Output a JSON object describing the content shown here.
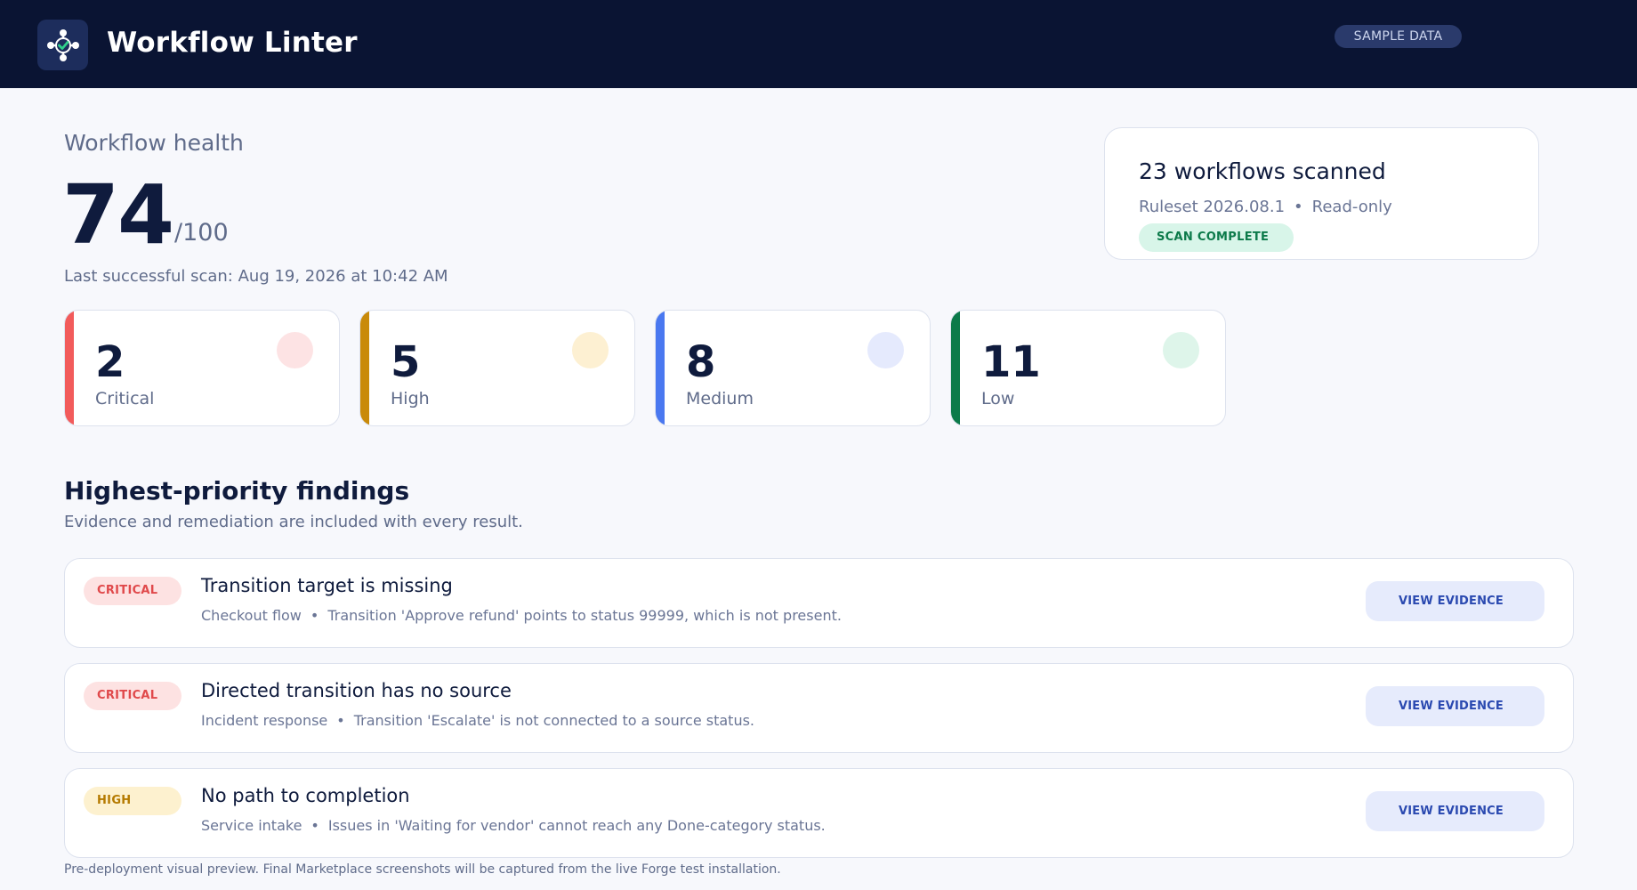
{
  "header": {
    "app_title": "Workflow Linter",
    "sample_badge": "SAMPLE DATA"
  },
  "health": {
    "label": "Workflow health",
    "score": "74",
    "score_max": "/100",
    "last_scan": "Last successful scan: Aug 19, 2026 at 10:42 AM"
  },
  "scan": {
    "title": "23 workflows scanned",
    "ruleset": "Ruleset 2026.08.1",
    "separator": "•",
    "mode": "Read-only",
    "status": "SCAN COMPLETE"
  },
  "severity": [
    {
      "count": "2",
      "label": "Critical",
      "accent": "#f25b5b",
      "circle": "#fde3e4"
    },
    {
      "count": "5",
      "label": "High",
      "accent": "#c98a0a",
      "circle": "#fdf0d2"
    },
    {
      "count": "8",
      "label": "Medium",
      "accent": "#4a78f0",
      "circle": "#e5eafd"
    },
    {
      "count": "11",
      "label": "Low",
      "accent": "#0c7a4a",
      "circle": "#def5ea"
    }
  ],
  "findings": {
    "title": "Highest-priority findings",
    "subtitle": "Evidence and remediation are included with every result.",
    "items": [
      {
        "severity": "CRITICAL",
        "title": "Transition target is missing",
        "workflow": "Checkout flow",
        "separator": "•",
        "detail": "Transition 'Approve refund' points to status 99999, which is not present.",
        "action": "VIEW EVIDENCE"
      },
      {
        "severity": "CRITICAL",
        "title": "Directed transition has no source",
        "workflow": "Incident response",
        "separator": "•",
        "detail": "Transition 'Escalate' is not connected to a source status.",
        "action": "VIEW EVIDENCE"
      },
      {
        "severity": "HIGH",
        "title": "No path to completion",
        "workflow": "Service intake",
        "separator": "•",
        "detail": "Issues in 'Waiting for vendor' cannot reach any Done-category status.",
        "action": "VIEW EVIDENCE"
      }
    ]
  },
  "footer": {
    "note": "Pre-deployment visual preview. Final Marketplace screenshots will be captured from the live Forge test installation."
  }
}
